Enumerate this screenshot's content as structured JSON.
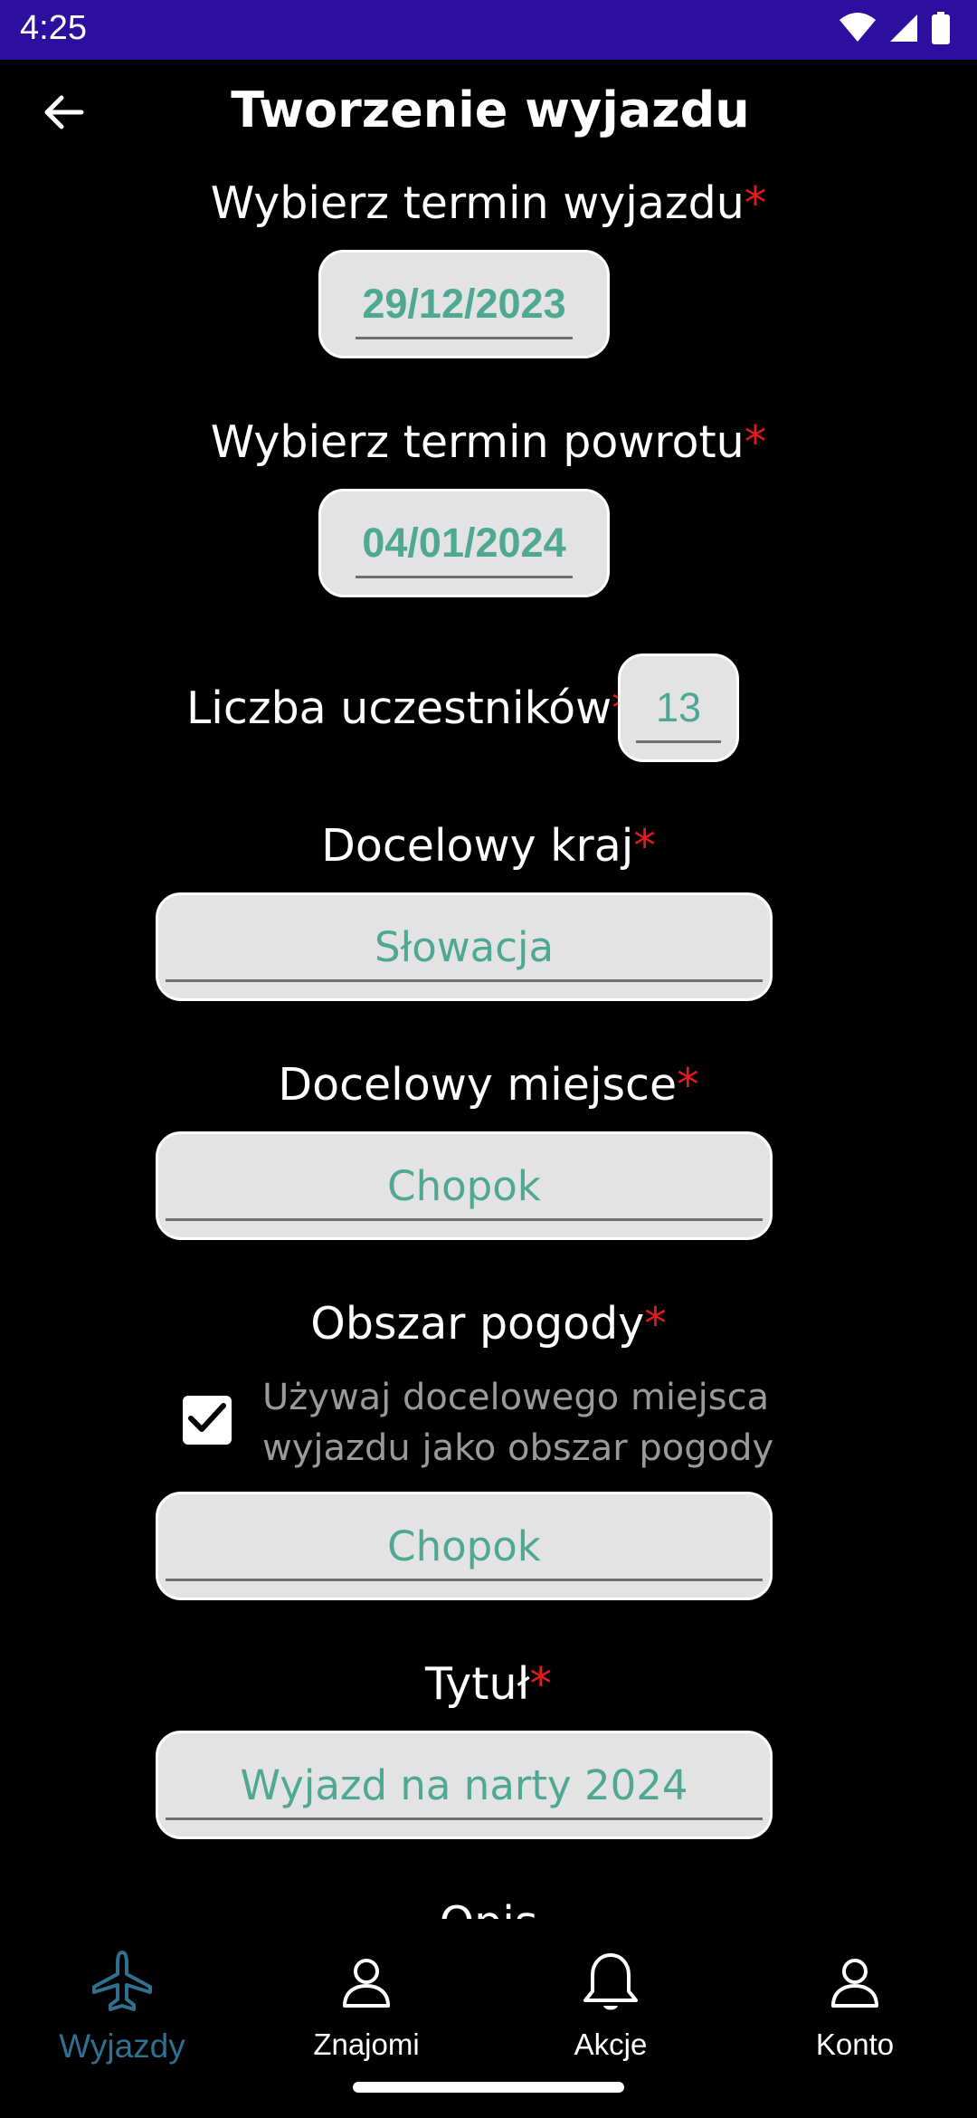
{
  "status": {
    "time": "4:25"
  },
  "header": {
    "title": "Tworzenie wyjazdu"
  },
  "form": {
    "required_mark": "*",
    "departure": {
      "label": "Wybierz termin wyjazdu",
      "value": "29/12/2023"
    },
    "return": {
      "label": "Wybierz termin powrotu",
      "value": "04/01/2024"
    },
    "participants": {
      "label": "Liczba uczestników",
      "value": "13"
    },
    "country": {
      "label": "Docelowy kraj",
      "value": "Słowacja"
    },
    "place": {
      "label": "Docelowy miejsce",
      "value": "Chopok"
    },
    "weather": {
      "label": "Obszar pogody",
      "checkbox_checked": true,
      "checkbox_text_line1": "Używaj docelowego miejsca",
      "checkbox_text_line2": "wyjazdu jako obszar pogody",
      "value": "Chopok"
    },
    "title": {
      "label": "Tytuł",
      "value": "Wyjazd na narty 2024"
    },
    "description": {
      "label": "Opis"
    }
  },
  "nav": {
    "items": [
      {
        "label": "Wyjazdy",
        "icon": "airplane-icon",
        "active": true
      },
      {
        "label": "Znajomi",
        "icon": "person-icon",
        "active": false
      },
      {
        "label": "Akcje",
        "icon": "bell-icon",
        "active": false
      },
      {
        "label": "Konto",
        "icon": "person-icon",
        "active": false
      }
    ]
  },
  "colors": {
    "status_bar": "#2d0fa0",
    "field_bg": "#e3e3e3",
    "field_text": "#4fa892",
    "required": "#e31a1a",
    "nav_active": "#2f6f8f"
  }
}
